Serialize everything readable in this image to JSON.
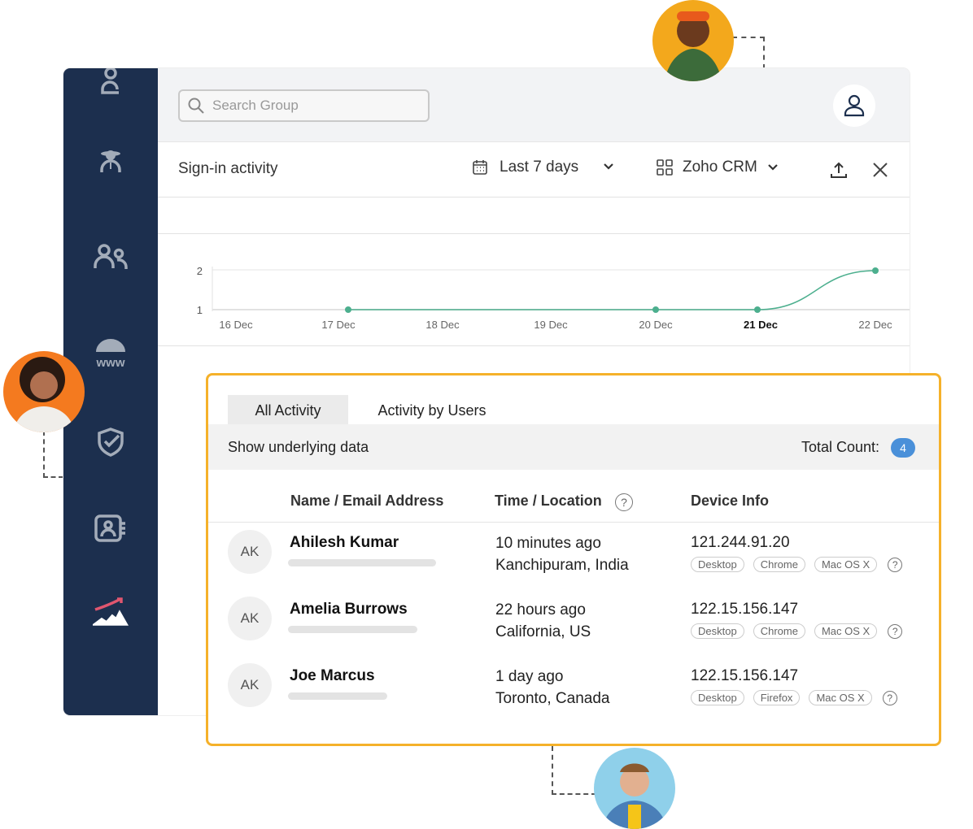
{
  "search": {
    "placeholder": "Search Group"
  },
  "toolbar": {
    "title": "Sign-in activity",
    "date_range": "Last 7 days",
    "app": "Zoho CRM"
  },
  "chart_data": {
    "type": "line",
    "categories": [
      "16 Dec",
      "17 Dec",
      "18 Dec",
      "19 Dec",
      "20 Dec",
      "21 Dec",
      "22 Dec"
    ],
    "values": [
      null,
      1,
      null,
      null,
      1,
      1,
      2
    ],
    "y_ticks": [
      "1",
      "2"
    ],
    "ylim": [
      1,
      2
    ],
    "highlighted_category": "21 Dec",
    "color": "#4caf8e",
    "grid": true
  },
  "panel": {
    "tabs": [
      {
        "label": "All Activity",
        "active": true
      },
      {
        "label": "Activity by Users",
        "active": false
      }
    ],
    "show_underlying": "Show underlying data",
    "total_label": "Total Count:",
    "total_count": "4",
    "columns": [
      "Name / Email Address",
      "Time / Location",
      "Device Info"
    ],
    "rows": [
      {
        "initials": "AK",
        "name": "Ahilesh Kumar",
        "time": "10 minutes ago",
        "location": "Kanchipuram, India",
        "ip": "121.244.91.20",
        "tags": [
          "Desktop",
          "Chrome",
          "Mac OS X"
        ]
      },
      {
        "initials": "AK",
        "name": "Amelia Burrows",
        "time": "22 hours ago",
        "location": "California, US",
        "ip": "122.15.156.147",
        "tags": [
          "Desktop",
          "Chrome",
          "Mac OS X"
        ]
      },
      {
        "initials": "AK",
        "name": "Joe Marcus",
        "time": "1 day ago",
        "location": "Toronto, Canada",
        "ip": "122.15.156.147",
        "tags": [
          "Desktop",
          "Firefox",
          "Mac OS X"
        ]
      }
    ]
  },
  "colors": {
    "sidebar": "#1c2f4e",
    "accent_border": "#f5b12a",
    "badge": "#4a90d9",
    "line": "#4caf8e"
  }
}
